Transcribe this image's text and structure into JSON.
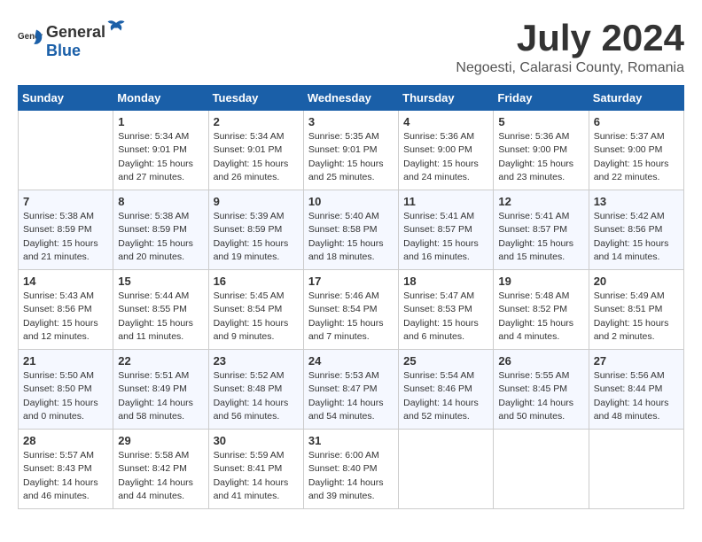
{
  "logo": {
    "text_general": "General",
    "text_blue": "Blue"
  },
  "title": {
    "month_year": "July 2024",
    "location": "Negoesti, Calarasi County, Romania"
  },
  "days_of_week": [
    "Sunday",
    "Monday",
    "Tuesday",
    "Wednesday",
    "Thursday",
    "Friday",
    "Saturday"
  ],
  "weeks": [
    [
      {
        "day": "",
        "info": ""
      },
      {
        "day": "1",
        "info": "Sunrise: 5:34 AM\nSunset: 9:01 PM\nDaylight: 15 hours\nand 27 minutes."
      },
      {
        "day": "2",
        "info": "Sunrise: 5:34 AM\nSunset: 9:01 PM\nDaylight: 15 hours\nand 26 minutes."
      },
      {
        "day": "3",
        "info": "Sunrise: 5:35 AM\nSunset: 9:01 PM\nDaylight: 15 hours\nand 25 minutes."
      },
      {
        "day": "4",
        "info": "Sunrise: 5:36 AM\nSunset: 9:00 PM\nDaylight: 15 hours\nand 24 minutes."
      },
      {
        "day": "5",
        "info": "Sunrise: 5:36 AM\nSunset: 9:00 PM\nDaylight: 15 hours\nand 23 minutes."
      },
      {
        "day": "6",
        "info": "Sunrise: 5:37 AM\nSunset: 9:00 PM\nDaylight: 15 hours\nand 22 minutes."
      }
    ],
    [
      {
        "day": "7",
        "info": "Sunrise: 5:38 AM\nSunset: 8:59 PM\nDaylight: 15 hours\nand 21 minutes."
      },
      {
        "day": "8",
        "info": "Sunrise: 5:38 AM\nSunset: 8:59 PM\nDaylight: 15 hours\nand 20 minutes."
      },
      {
        "day": "9",
        "info": "Sunrise: 5:39 AM\nSunset: 8:59 PM\nDaylight: 15 hours\nand 19 minutes."
      },
      {
        "day": "10",
        "info": "Sunrise: 5:40 AM\nSunset: 8:58 PM\nDaylight: 15 hours\nand 18 minutes."
      },
      {
        "day": "11",
        "info": "Sunrise: 5:41 AM\nSunset: 8:57 PM\nDaylight: 15 hours\nand 16 minutes."
      },
      {
        "day": "12",
        "info": "Sunrise: 5:41 AM\nSunset: 8:57 PM\nDaylight: 15 hours\nand 15 minutes."
      },
      {
        "day": "13",
        "info": "Sunrise: 5:42 AM\nSunset: 8:56 PM\nDaylight: 15 hours\nand 14 minutes."
      }
    ],
    [
      {
        "day": "14",
        "info": "Sunrise: 5:43 AM\nSunset: 8:56 PM\nDaylight: 15 hours\nand 12 minutes."
      },
      {
        "day": "15",
        "info": "Sunrise: 5:44 AM\nSunset: 8:55 PM\nDaylight: 15 hours\nand 11 minutes."
      },
      {
        "day": "16",
        "info": "Sunrise: 5:45 AM\nSunset: 8:54 PM\nDaylight: 15 hours\nand 9 minutes."
      },
      {
        "day": "17",
        "info": "Sunrise: 5:46 AM\nSunset: 8:54 PM\nDaylight: 15 hours\nand 7 minutes."
      },
      {
        "day": "18",
        "info": "Sunrise: 5:47 AM\nSunset: 8:53 PM\nDaylight: 15 hours\nand 6 minutes."
      },
      {
        "day": "19",
        "info": "Sunrise: 5:48 AM\nSunset: 8:52 PM\nDaylight: 15 hours\nand 4 minutes."
      },
      {
        "day": "20",
        "info": "Sunrise: 5:49 AM\nSunset: 8:51 PM\nDaylight: 15 hours\nand 2 minutes."
      }
    ],
    [
      {
        "day": "21",
        "info": "Sunrise: 5:50 AM\nSunset: 8:50 PM\nDaylight: 15 hours\nand 0 minutes."
      },
      {
        "day": "22",
        "info": "Sunrise: 5:51 AM\nSunset: 8:49 PM\nDaylight: 14 hours\nand 58 minutes."
      },
      {
        "day": "23",
        "info": "Sunrise: 5:52 AM\nSunset: 8:48 PM\nDaylight: 14 hours\nand 56 minutes."
      },
      {
        "day": "24",
        "info": "Sunrise: 5:53 AM\nSunset: 8:47 PM\nDaylight: 14 hours\nand 54 minutes."
      },
      {
        "day": "25",
        "info": "Sunrise: 5:54 AM\nSunset: 8:46 PM\nDaylight: 14 hours\nand 52 minutes."
      },
      {
        "day": "26",
        "info": "Sunrise: 5:55 AM\nSunset: 8:45 PM\nDaylight: 14 hours\nand 50 minutes."
      },
      {
        "day": "27",
        "info": "Sunrise: 5:56 AM\nSunset: 8:44 PM\nDaylight: 14 hours\nand 48 minutes."
      }
    ],
    [
      {
        "day": "28",
        "info": "Sunrise: 5:57 AM\nSunset: 8:43 PM\nDaylight: 14 hours\nand 46 minutes."
      },
      {
        "day": "29",
        "info": "Sunrise: 5:58 AM\nSunset: 8:42 PM\nDaylight: 14 hours\nand 44 minutes."
      },
      {
        "day": "30",
        "info": "Sunrise: 5:59 AM\nSunset: 8:41 PM\nDaylight: 14 hours\nand 41 minutes."
      },
      {
        "day": "31",
        "info": "Sunrise: 6:00 AM\nSunset: 8:40 PM\nDaylight: 14 hours\nand 39 minutes."
      },
      {
        "day": "",
        "info": ""
      },
      {
        "day": "",
        "info": ""
      },
      {
        "day": "",
        "info": ""
      }
    ]
  ]
}
